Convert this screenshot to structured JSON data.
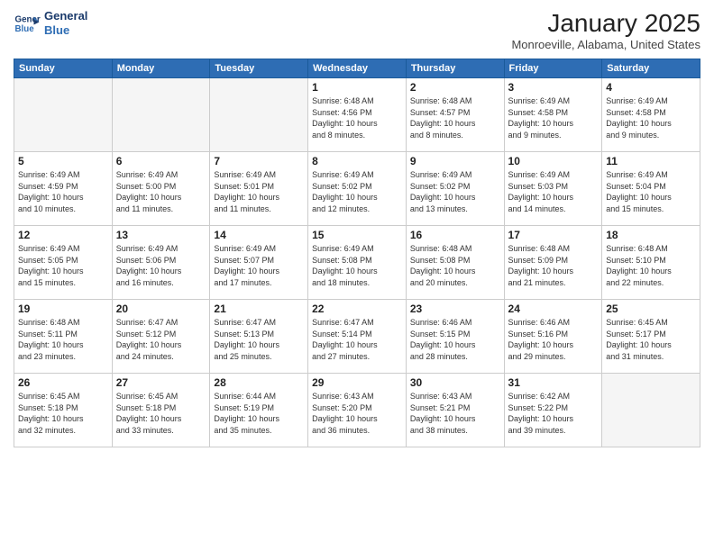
{
  "logo": {
    "line1": "General",
    "line2": "Blue"
  },
  "title": "January 2025",
  "location": "Monroeville, Alabama, United States",
  "weekdays": [
    "Sunday",
    "Monday",
    "Tuesday",
    "Wednesday",
    "Thursday",
    "Friday",
    "Saturday"
  ],
  "weeks": [
    [
      {
        "num": "",
        "info": ""
      },
      {
        "num": "",
        "info": ""
      },
      {
        "num": "",
        "info": ""
      },
      {
        "num": "1",
        "info": "Sunrise: 6:48 AM\nSunset: 4:56 PM\nDaylight: 10 hours\nand 8 minutes."
      },
      {
        "num": "2",
        "info": "Sunrise: 6:48 AM\nSunset: 4:57 PM\nDaylight: 10 hours\nand 8 minutes."
      },
      {
        "num": "3",
        "info": "Sunrise: 6:49 AM\nSunset: 4:58 PM\nDaylight: 10 hours\nand 9 minutes."
      },
      {
        "num": "4",
        "info": "Sunrise: 6:49 AM\nSunset: 4:58 PM\nDaylight: 10 hours\nand 9 minutes."
      }
    ],
    [
      {
        "num": "5",
        "info": "Sunrise: 6:49 AM\nSunset: 4:59 PM\nDaylight: 10 hours\nand 10 minutes."
      },
      {
        "num": "6",
        "info": "Sunrise: 6:49 AM\nSunset: 5:00 PM\nDaylight: 10 hours\nand 11 minutes."
      },
      {
        "num": "7",
        "info": "Sunrise: 6:49 AM\nSunset: 5:01 PM\nDaylight: 10 hours\nand 11 minutes."
      },
      {
        "num": "8",
        "info": "Sunrise: 6:49 AM\nSunset: 5:02 PM\nDaylight: 10 hours\nand 12 minutes."
      },
      {
        "num": "9",
        "info": "Sunrise: 6:49 AM\nSunset: 5:02 PM\nDaylight: 10 hours\nand 13 minutes."
      },
      {
        "num": "10",
        "info": "Sunrise: 6:49 AM\nSunset: 5:03 PM\nDaylight: 10 hours\nand 14 minutes."
      },
      {
        "num": "11",
        "info": "Sunrise: 6:49 AM\nSunset: 5:04 PM\nDaylight: 10 hours\nand 15 minutes."
      }
    ],
    [
      {
        "num": "12",
        "info": "Sunrise: 6:49 AM\nSunset: 5:05 PM\nDaylight: 10 hours\nand 15 minutes."
      },
      {
        "num": "13",
        "info": "Sunrise: 6:49 AM\nSunset: 5:06 PM\nDaylight: 10 hours\nand 16 minutes."
      },
      {
        "num": "14",
        "info": "Sunrise: 6:49 AM\nSunset: 5:07 PM\nDaylight: 10 hours\nand 17 minutes."
      },
      {
        "num": "15",
        "info": "Sunrise: 6:49 AM\nSunset: 5:08 PM\nDaylight: 10 hours\nand 18 minutes."
      },
      {
        "num": "16",
        "info": "Sunrise: 6:48 AM\nSunset: 5:08 PM\nDaylight: 10 hours\nand 20 minutes."
      },
      {
        "num": "17",
        "info": "Sunrise: 6:48 AM\nSunset: 5:09 PM\nDaylight: 10 hours\nand 21 minutes."
      },
      {
        "num": "18",
        "info": "Sunrise: 6:48 AM\nSunset: 5:10 PM\nDaylight: 10 hours\nand 22 minutes."
      }
    ],
    [
      {
        "num": "19",
        "info": "Sunrise: 6:48 AM\nSunset: 5:11 PM\nDaylight: 10 hours\nand 23 minutes."
      },
      {
        "num": "20",
        "info": "Sunrise: 6:47 AM\nSunset: 5:12 PM\nDaylight: 10 hours\nand 24 minutes."
      },
      {
        "num": "21",
        "info": "Sunrise: 6:47 AM\nSunset: 5:13 PM\nDaylight: 10 hours\nand 25 minutes."
      },
      {
        "num": "22",
        "info": "Sunrise: 6:47 AM\nSunset: 5:14 PM\nDaylight: 10 hours\nand 27 minutes."
      },
      {
        "num": "23",
        "info": "Sunrise: 6:46 AM\nSunset: 5:15 PM\nDaylight: 10 hours\nand 28 minutes."
      },
      {
        "num": "24",
        "info": "Sunrise: 6:46 AM\nSunset: 5:16 PM\nDaylight: 10 hours\nand 29 minutes."
      },
      {
        "num": "25",
        "info": "Sunrise: 6:45 AM\nSunset: 5:17 PM\nDaylight: 10 hours\nand 31 minutes."
      }
    ],
    [
      {
        "num": "26",
        "info": "Sunrise: 6:45 AM\nSunset: 5:18 PM\nDaylight: 10 hours\nand 32 minutes."
      },
      {
        "num": "27",
        "info": "Sunrise: 6:45 AM\nSunset: 5:18 PM\nDaylight: 10 hours\nand 33 minutes."
      },
      {
        "num": "28",
        "info": "Sunrise: 6:44 AM\nSunset: 5:19 PM\nDaylight: 10 hours\nand 35 minutes."
      },
      {
        "num": "29",
        "info": "Sunrise: 6:43 AM\nSunset: 5:20 PM\nDaylight: 10 hours\nand 36 minutes."
      },
      {
        "num": "30",
        "info": "Sunrise: 6:43 AM\nSunset: 5:21 PM\nDaylight: 10 hours\nand 38 minutes."
      },
      {
        "num": "31",
        "info": "Sunrise: 6:42 AM\nSunset: 5:22 PM\nDaylight: 10 hours\nand 39 minutes."
      },
      {
        "num": "",
        "info": ""
      }
    ]
  ]
}
